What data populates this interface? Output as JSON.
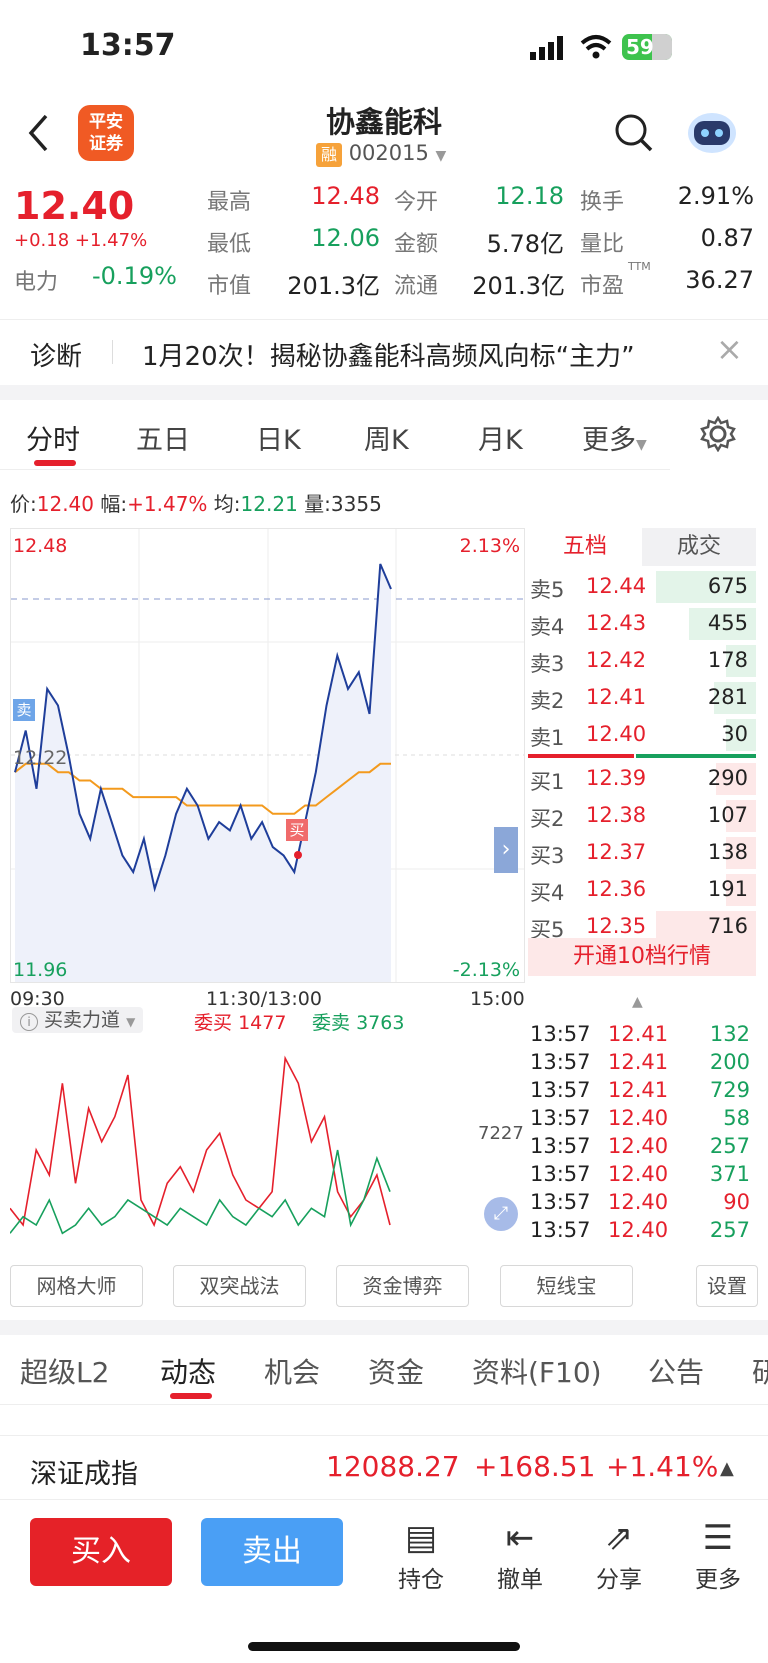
{
  "status": {
    "time": "13:57",
    "battery": "59"
  },
  "nav": {
    "title": "协鑫能科",
    "code": "002015",
    "rong": "融",
    "broker_logo": "平安\n证券"
  },
  "quote": {
    "price": "12.40",
    "change": "+0.18",
    "change_pct": "+1.47%",
    "high_label": "最高",
    "high": "12.48",
    "open_label": "今开",
    "open": "12.18",
    "turnover_label": "换手",
    "turnover": "2.91%",
    "low_label": "最低",
    "low": "12.06",
    "amount_label": "金额",
    "amount": "5.78亿",
    "vr_label": "量比",
    "vr": "0.87",
    "sector_label": "电力",
    "sector_chg": "-0.19%",
    "mcap_label": "市值",
    "mcap": "201.3亿",
    "float_label": "流通",
    "float": "201.3亿",
    "pe_label": "市盈",
    "pe_sup": "TTM",
    "pe": "36.27"
  },
  "diag": {
    "label": "诊断",
    "text": "1月20次！揭秘协鑫能科高频风向标“主力”"
  },
  "period_tabs": [
    "分时",
    "五日",
    "日K",
    "周K",
    "月K",
    "更多"
  ],
  "infoline": {
    "price_label": "价:",
    "price": "12.40",
    "amp_label": "幅:",
    "amp": "+1.47%",
    "avg_label": "均:",
    "avg": "12.21",
    "vol_label": "量:",
    "vol": "3355"
  },
  "chart": {
    "top_price": "12.48",
    "top_pct": "2.13%",
    "bot_price": "11.96",
    "bot_pct": "-2.13%",
    "mid_price": "12.22",
    "sell_tag": "卖",
    "buy_tag": "买",
    "t_start": "09:30",
    "t_mid": "11:30/13:00",
    "t_end": "15:00"
  },
  "chart_data": {
    "type": "line",
    "x_ticks": [
      "09:30",
      "11:30/13:00",
      "15:00"
    ],
    "ylim": [
      11.96,
      12.48
    ],
    "y_pct": [
      "2.13%",
      "-2.13%"
    ],
    "series": [],
    "price": [
      12.2,
      12.25,
      12.18,
      12.3,
      12.28,
      12.22,
      12.15,
      12.12,
      12.18,
      12.14,
      12.1,
      12.08,
      12.12,
      12.06,
      12.1,
      12.15,
      12.18,
      12.16,
      12.12,
      12.14,
      12.13,
      12.16,
      12.12,
      12.14,
      12.11,
      12.1,
      12.08,
      12.14,
      12.2,
      12.28,
      12.34,
      12.3,
      12.32,
      12.27,
      12.45,
      12.42
    ],
    "avg": [
      12.2,
      12.21,
      12.21,
      12.21,
      12.2,
      12.2,
      12.19,
      12.19,
      12.18,
      12.18,
      12.18,
      12.17,
      12.17,
      12.17,
      12.17,
      12.17,
      12.16,
      12.16,
      12.16,
      12.16,
      12.16,
      12.16,
      12.16,
      12.16,
      12.15,
      12.15,
      12.15,
      12.16,
      12.16,
      12.17,
      12.18,
      12.19,
      12.2,
      12.2,
      12.21,
      12.21
    ]
  },
  "orderbook": {
    "tab_active": "五档",
    "tab_other": "成交",
    "asks": [
      {
        "label": "卖5",
        "price": "12.44",
        "vol": "675"
      },
      {
        "label": "卖4",
        "price": "12.43",
        "vol": "455"
      },
      {
        "label": "卖3",
        "price": "12.42",
        "vol": "178"
      },
      {
        "label": "卖2",
        "price": "12.41",
        "vol": "281"
      },
      {
        "label": "卖1",
        "price": "12.40",
        "vol": "30"
      }
    ],
    "bids": [
      {
        "label": "买1",
        "price": "12.39",
        "vol": "290"
      },
      {
        "label": "买2",
        "price": "12.38",
        "vol": "107"
      },
      {
        "label": "买3",
        "price": "12.37",
        "vol": "138"
      },
      {
        "label": "买4",
        "price": "12.36",
        "vol": "191"
      },
      {
        "label": "买5",
        "price": "12.35",
        "vol": "716"
      }
    ],
    "promo": "开通10档行情"
  },
  "ticks": [
    {
      "t": "13:57",
      "p": "12.41",
      "v": "132",
      "c": "green"
    },
    {
      "t": "13:57",
      "p": "12.41",
      "v": "200",
      "c": "green"
    },
    {
      "t": "13:57",
      "p": "12.41",
      "v": "729",
      "c": "green"
    },
    {
      "t": "13:57",
      "p": "12.40",
      "v": "58",
      "c": "green"
    },
    {
      "t": "13:57",
      "p": "12.40",
      "v": "257",
      "c": "green"
    },
    {
      "t": "13:57",
      "p": "12.40",
      "v": "371",
      "c": "green"
    },
    {
      "t": "13:57",
      "p": "12.40",
      "v": "90",
      "c": "red"
    },
    {
      "t": "13:57",
      "p": "12.40",
      "v": "257",
      "c": "green"
    }
  ],
  "indicator": {
    "name": "买卖力道",
    "buy_label": "委买",
    "buy": "1477",
    "sell_label": "委卖",
    "sell": "3763",
    "ref": "7227",
    "red": [
      50,
      30,
      120,
      90,
      200,
      80,
      170,
      130,
      160,
      210,
      60,
      30,
      80,
      100,
      70,
      120,
      140,
      90,
      60,
      50,
      70,
      230,
      200,
      130,
      160,
      70,
      40,
      60,
      90,
      30
    ],
    "green": [
      20,
      40,
      30,
      60,
      20,
      30,
      50,
      30,
      40,
      60,
      50,
      40,
      30,
      50,
      40,
      30,
      60,
      40,
      30,
      50,
      40,
      60,
      30,
      50,
      40,
      120,
      30,
      60,
      110,
      70
    ]
  },
  "tools": [
    "网格大师",
    "双突战法",
    "资金博弈",
    "短线宝",
    "设置"
  ],
  "lower_tabs": [
    "超级L2",
    "动态",
    "机会",
    "资金",
    "资料(F10)",
    "公告",
    "研"
  ],
  "index": {
    "name": "深证成指",
    "value": "12088.27",
    "chg": "+168.51",
    "pct": "+1.41%"
  },
  "bottom": {
    "buy": "买入",
    "sell": "卖出",
    "hold": "持仓",
    "cancel": "撤单",
    "share": "分享",
    "more": "更多"
  },
  "colors": {
    "up": "#e5202c",
    "down": "#17a05d",
    "accent": "#4a9ff5",
    "price_line": "#1f3e9a",
    "avg_line": "#f39a1d"
  }
}
